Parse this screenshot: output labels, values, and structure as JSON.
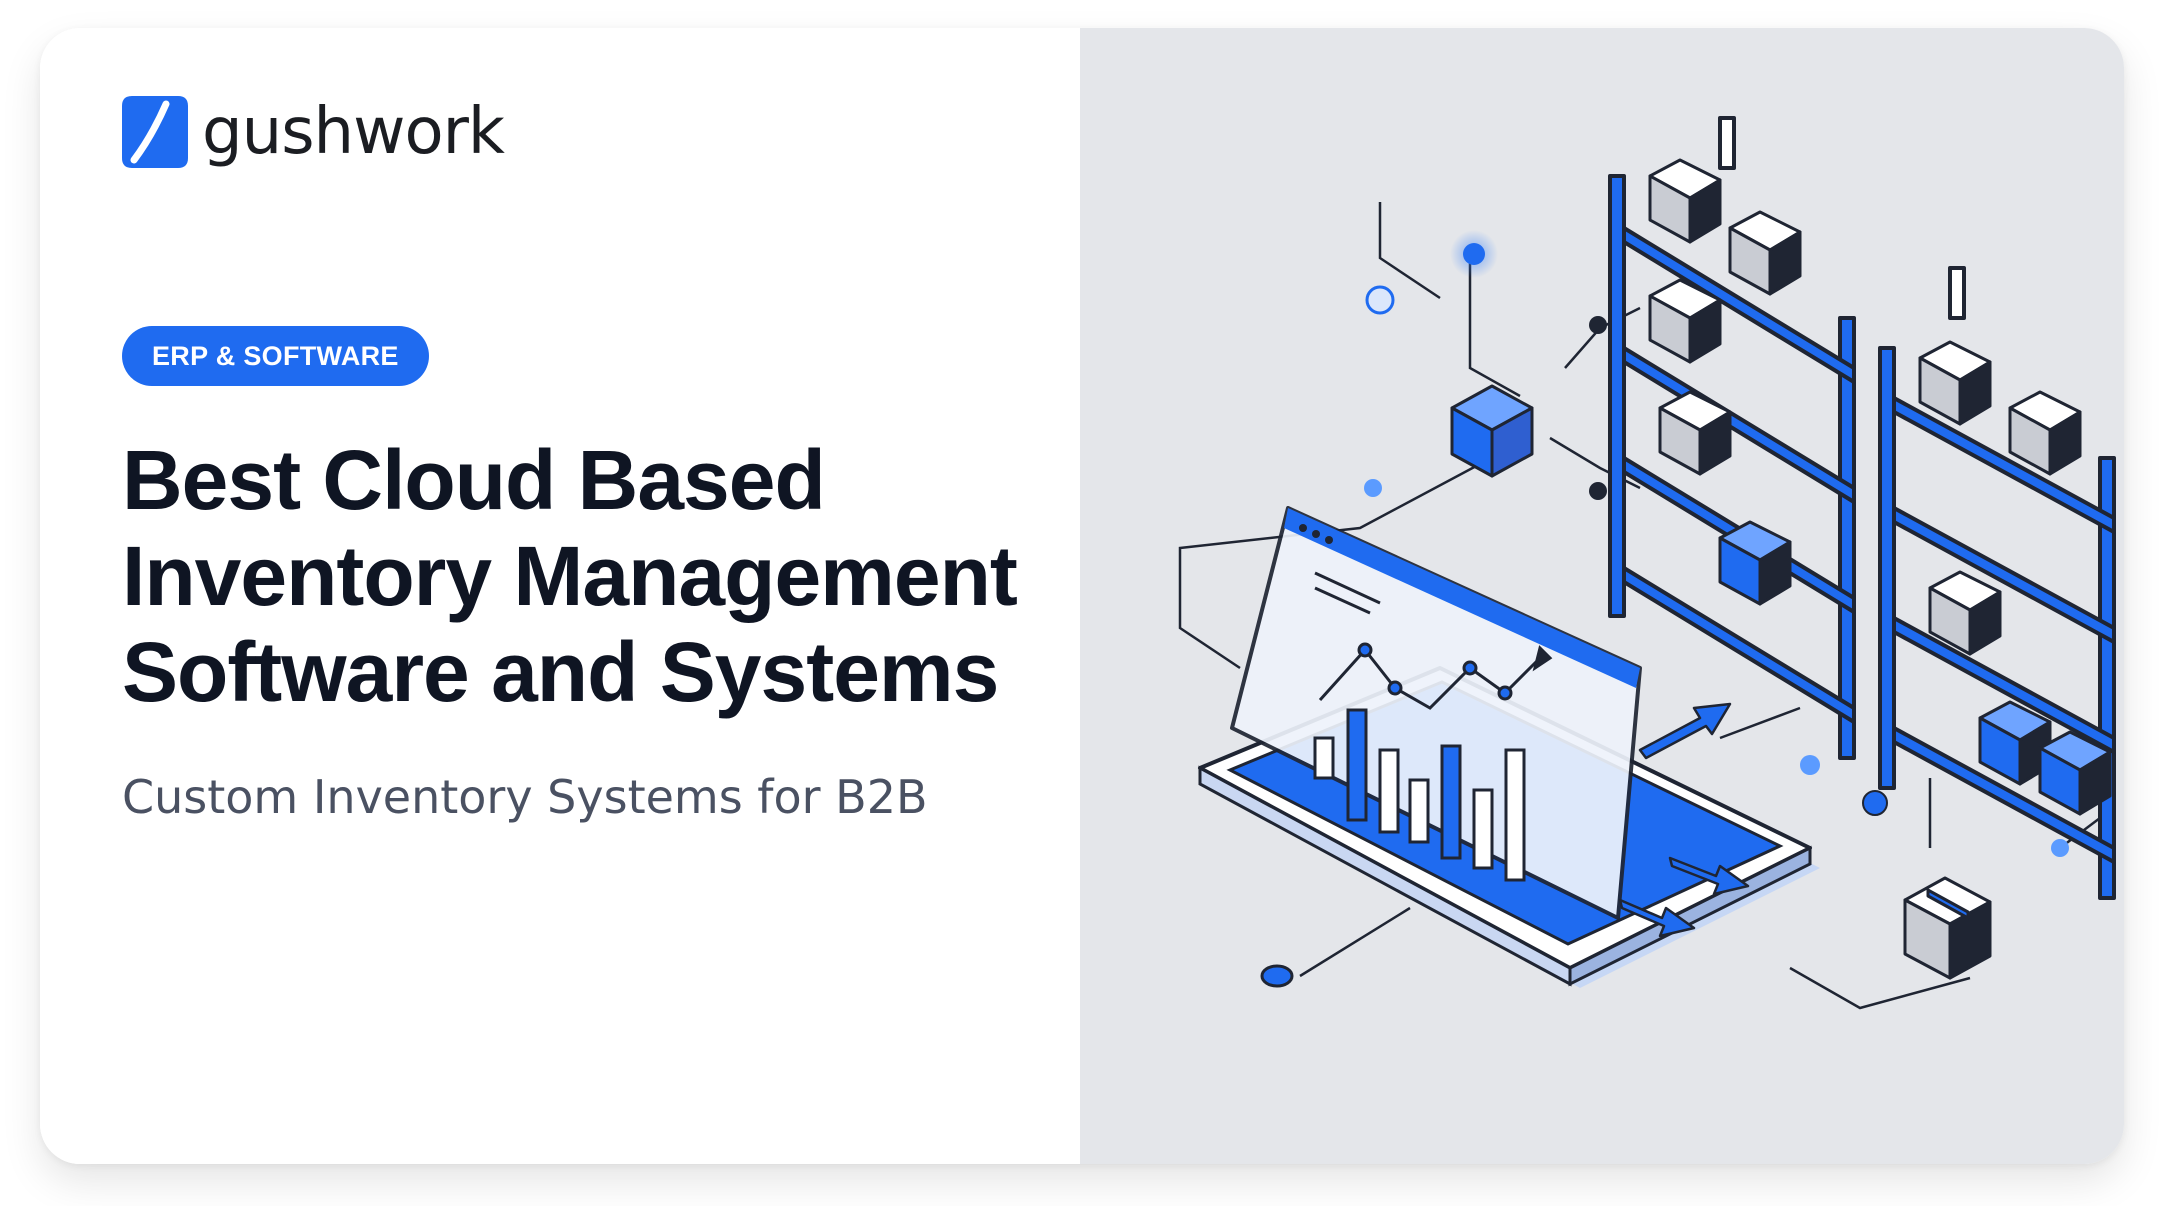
{
  "brand": {
    "name": "gushwork",
    "accent_color": "#1f6bf0",
    "logo_icon": "gushwork-logo-icon"
  },
  "category_badge": "ERP & SOFTWARE",
  "title_lines": [
    "Best Cloud Based",
    "Inventory Management",
    "Software and Systems"
  ],
  "subtitle": "Custom Inventory Systems for B2B",
  "illustration": {
    "icons": [
      "laptop-dashboard-icon",
      "bar-chart-icon",
      "warehouse-shelf-icon",
      "package-box-icon",
      "network-node-icon"
    ]
  }
}
